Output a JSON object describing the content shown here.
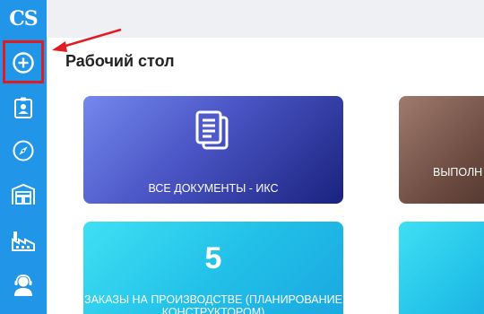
{
  "sidebar": {
    "logo": "CS",
    "items": [
      {
        "icon": "add-circle-icon"
      },
      {
        "icon": "contact-badge-icon"
      },
      {
        "icon": "compass-icon"
      },
      {
        "icon": "warehouse-icon"
      },
      {
        "icon": "factory-icon"
      },
      {
        "icon": "support-agent-icon"
      }
    ]
  },
  "main": {
    "title": "Рабочий стол",
    "tiles": [
      {
        "label": "ВСЕ ДОКУМЕНТЫ - ИКС",
        "icon": "documents-icon"
      },
      {
        "label": "ВЫПОЛН"
      },
      {
        "count": "5",
        "label": "ЗАКАЗЫ НА ПРОИЗВОДСТВЕ (ПЛАНИРОВАНИЕ КОНСТРУКТОРОМ)"
      },
      {
        "label": ""
      }
    ]
  },
  "colors": {
    "sidebar": "#2196e8",
    "highlight": "#e11b22",
    "tile_docs": "#3f51b5",
    "tile_exec": "#6d4c41",
    "tile_orders": "#22c1e8"
  }
}
